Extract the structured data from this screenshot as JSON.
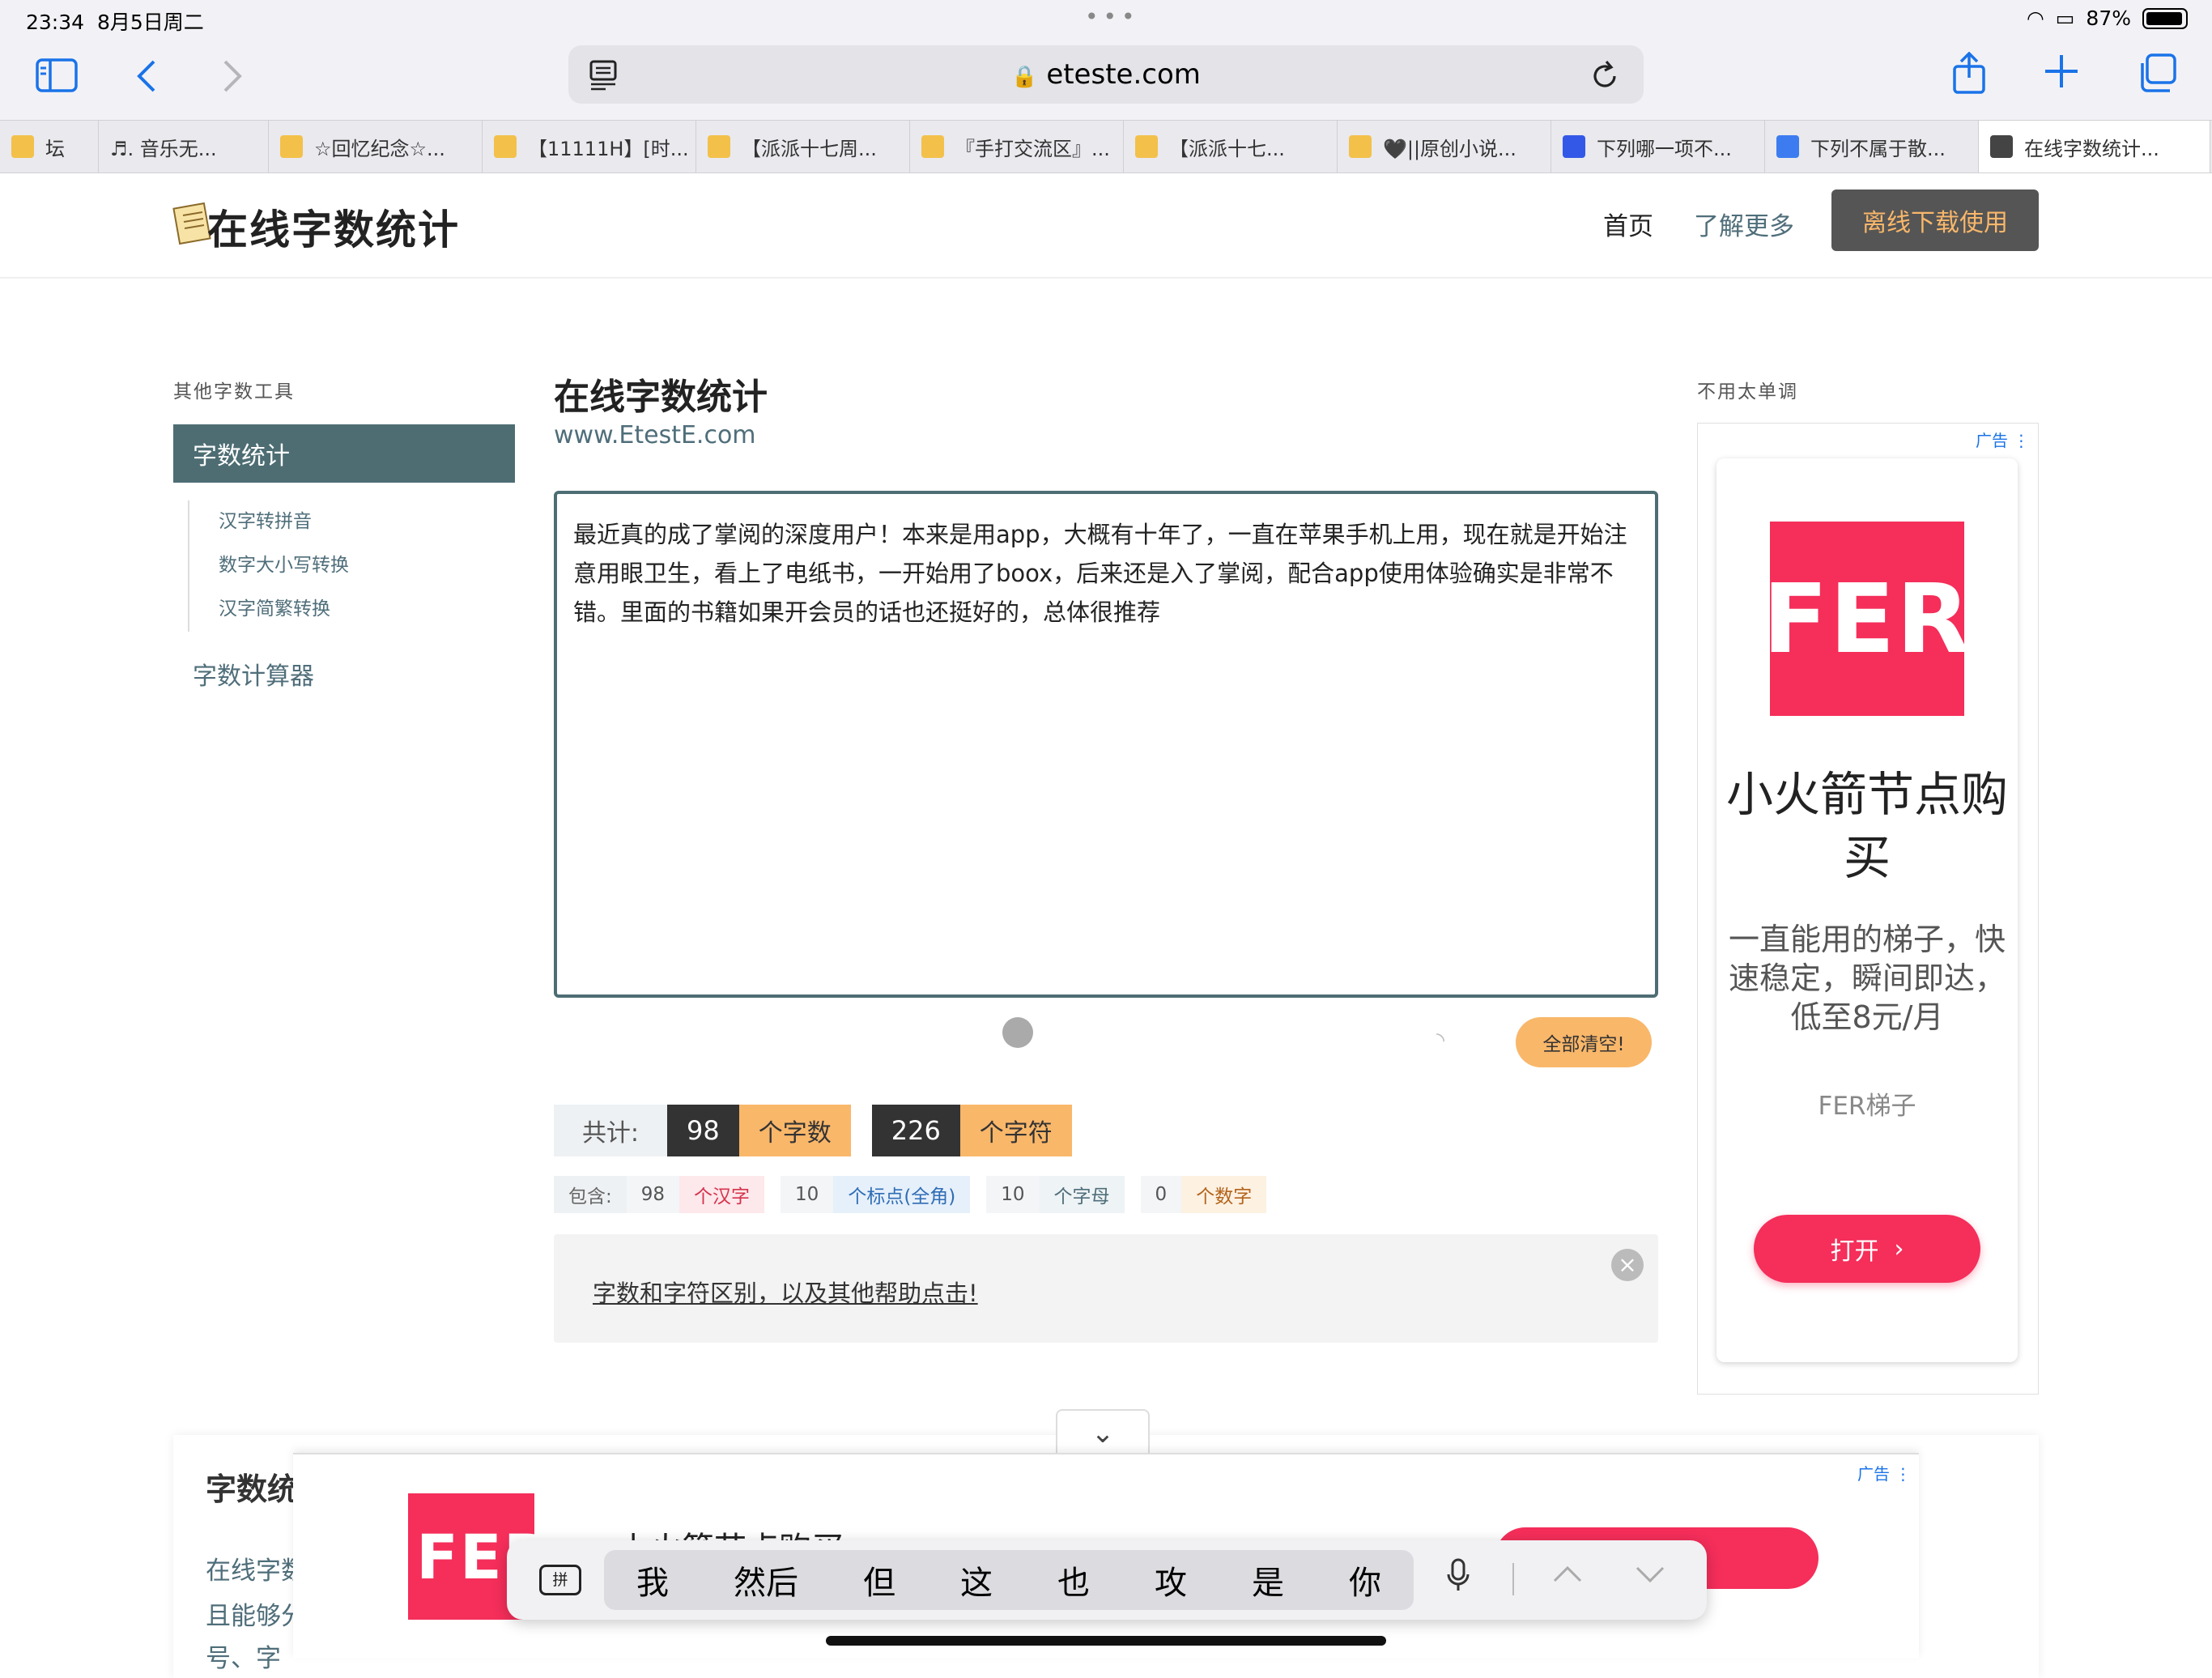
{
  "status": {
    "time": "23:34",
    "date": "8月5日周二",
    "battery": "87%"
  },
  "browser": {
    "url": "eteste.com",
    "tabs": [
      {
        "label": "坛",
        "icon_color": "#f3c04a"
      },
      {
        "label": "♬. 音乐无...",
        "icon_color": ""
      },
      {
        "label": "☆回忆纪念☆...",
        "icon_color": "#f3c04a"
      },
      {
        "label": "【11111H】[时...",
        "icon_color": "#f3c04a"
      },
      {
        "label": "【派派十七周...",
        "icon_color": "#f3c04a"
      },
      {
        "label": "『手打交流区』...",
        "icon_color": "#f3c04a"
      },
      {
        "label": "【派派十七...",
        "icon_color": "#f3c04a"
      },
      {
        "label": "🖤||原创小说...",
        "icon_color": "#f3c04a"
      },
      {
        "label": "下列哪一项不...",
        "icon_color": "#3358e8"
      },
      {
        "label": "下列不属于散...",
        "icon_color": "#3d7cf0"
      },
      {
        "label": "在线字数统计...",
        "icon_color": "#444444"
      }
    ]
  },
  "site": {
    "logo": "在线字数统计",
    "nav": {
      "home": "首页",
      "more": "了解更多",
      "download": "离线下载使用"
    }
  },
  "sidebar": {
    "heading": "其他字数工具",
    "active": "字数统计",
    "sub_items": [
      "汉字转拼音",
      "数字大小写转换",
      "汉字简繁转换"
    ],
    "calc": "字数计算器"
  },
  "main": {
    "title": "在线字数统计",
    "subtitle": "www.EtestE.com",
    "text": "最近真的成了掌阅的深度用户！本来是用app，大概有十年了，一直在苹果手机上用，现在就是开始注意用眼卫生，看上了电纸书，一开始用了boox，后来还是入了掌阅，配合app使用体验确实是非常不错。里面的书籍如果开会员的话也还挺好的，总体很推荐",
    "clear_button": "全部清空!",
    "total_label": "共计:",
    "char_count": "98",
    "char_count_label": "个字数",
    "symbol_count": "226",
    "symbol_count_label": "个字符",
    "contains_label": "包含:",
    "breakdown": [
      {
        "num": "98",
        "label": "个汉字",
        "bg": "#fde8ec",
        "fg": "#d6334a"
      },
      {
        "num": "10",
        "label": "个标点(全角)",
        "bg": "#e6f0fb",
        "fg": "#2f6db5"
      },
      {
        "num": "10",
        "label": "个字母",
        "bg": "#eef3f5",
        "fg": "#4f6e7a"
      },
      {
        "num": "0",
        "label": "个数字",
        "bg": "#fdf1e2",
        "fg": "#b3641c"
      }
    ],
    "help_link": "字数和字符区别，以及其他帮助点击!"
  },
  "ad": {
    "heading": "不用太单调",
    "tag": "广告",
    "logo": "FER",
    "title": "小火箭节点购买",
    "desc": "一直能用的梯子，快速稳定，瞬间即达，低至8元/月",
    "brand": "FER梯子",
    "open": "打开"
  },
  "lower": {
    "title": "字数统",
    "lines": [
      "在线字数",
      "且能够分",
      "号、字"
    ]
  },
  "bottom_ad": {
    "tag": "广告",
    "logo": "FER",
    "title": "小火箭节点购买"
  },
  "keyboard": {
    "ime": "拼",
    "suggestions": [
      "我",
      "然后",
      "但",
      "这",
      "也",
      "攻",
      "是",
      "你"
    ]
  }
}
